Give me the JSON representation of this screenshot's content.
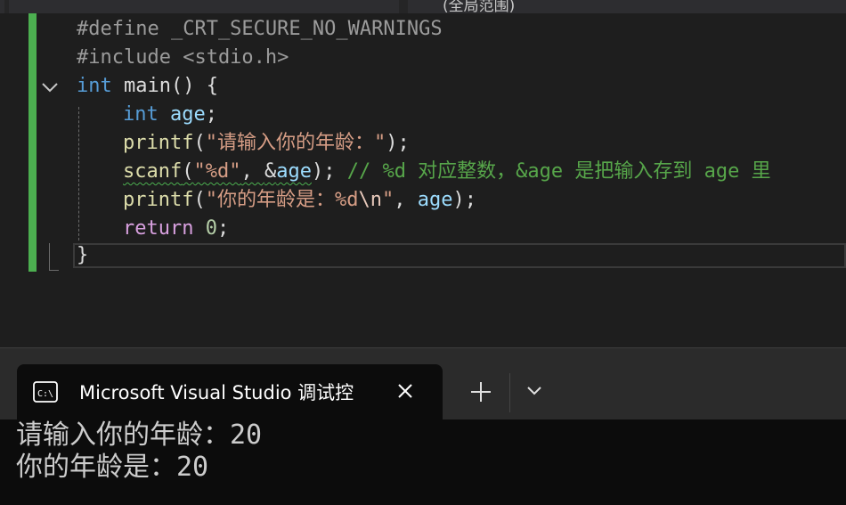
{
  "window": {
    "top_tab_text": "(全局范围)"
  },
  "editor": {
    "lines": [
      {
        "pp": "#define _CRT_SECURE_NO_WARNINGS"
      },
      {
        "pp": "#include <stdio.h>"
      },
      {
        "kw": "int",
        "rest": " main() {"
      },
      {
        "kw": "int",
        "var": "age",
        "semi": ";"
      },
      {
        "fn": "printf",
        "open": "(",
        "str": "\"请输入你的年龄：\"",
        "close": ");"
      },
      {
        "fn": "scanf",
        "open": "(",
        "str": "\"%d\"",
        "comma": ", ",
        "amp": "&",
        "var": "age",
        "close": ");",
        "comment": " // %d 对应整数，&age 是把输入存到 age 里"
      },
      {
        "fn": "printf",
        "open": "(",
        "str1": "\"你的年龄是：%d",
        "esc": "\\n",
        "str2": "\"",
        "comma": ", ",
        "var": "age",
        "close": ");"
      },
      {
        "ctl": "return",
        "num": "0",
        "semi": ";"
      },
      {
        "brace": "}"
      }
    ]
  },
  "terminal": {
    "tab_title": "Microsoft Visual Studio 调试控",
    "output_lines": [
      "请输入你的年龄：20",
      "你的年龄是：20"
    ]
  },
  "icons": {
    "fold": "chevron-down-icon",
    "terminal": "terminal-icon",
    "close": "close-icon",
    "add": "plus-icon",
    "dropdown": "chevron-down-icon"
  }
}
